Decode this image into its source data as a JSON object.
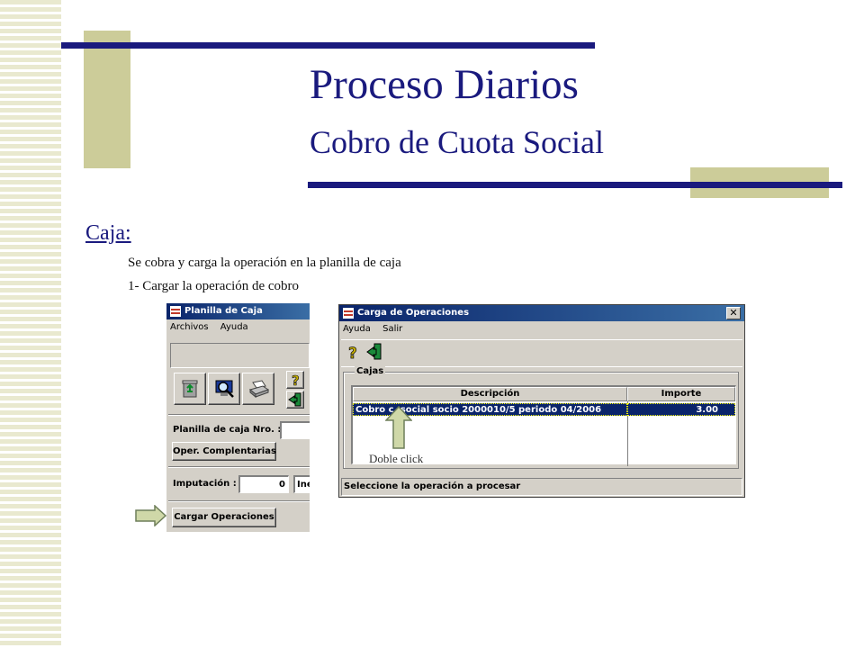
{
  "slide": {
    "title": "Proceso Diarios",
    "subtitle": "Cobro de Cuota Social",
    "section_heading": "Caja:",
    "body_lines": [
      "Se cobra y carga la operación en la planilla de caja",
      "1- Cargar la operación de cobro"
    ],
    "annotation": "Doble click",
    "colors": {
      "title": "#1a1a7e",
      "accent_block": "#cccc99",
      "rule": "#1a1a7e"
    }
  },
  "planilla_window": {
    "title": "Planilla de Caja",
    "menu": [
      "Archivos",
      "Ayuda"
    ],
    "toolbar_icons": [
      "recycle-icon",
      "search-computer-icon",
      "printer-icon",
      "help-icon",
      "exit-icon"
    ],
    "planilla_label": "Planilla de caja Nro. :",
    "planilla_value": "",
    "oper_button": "Oper. Complentarias",
    "imputacion_label": "Imputación :",
    "imputacion_value": "0",
    "imputacion_desc": "Ine",
    "cargar_button": "Cargar Operaciones"
  },
  "carga_window": {
    "title": "Carga de Operaciones",
    "close_label": "✕",
    "menu": [
      "Ayuda",
      "Salir"
    ],
    "toolbar_icons": [
      "help-icon",
      "exit-icon"
    ],
    "group_label": "Cajas",
    "columns": [
      "Descripción",
      "Importe"
    ],
    "rows": [
      {
        "descripcion": "Cobro c. social socio  2000010/5 periodo 04/2006",
        "importe": "3.00"
      }
    ],
    "status": "Seleccione la operación a procesar"
  }
}
